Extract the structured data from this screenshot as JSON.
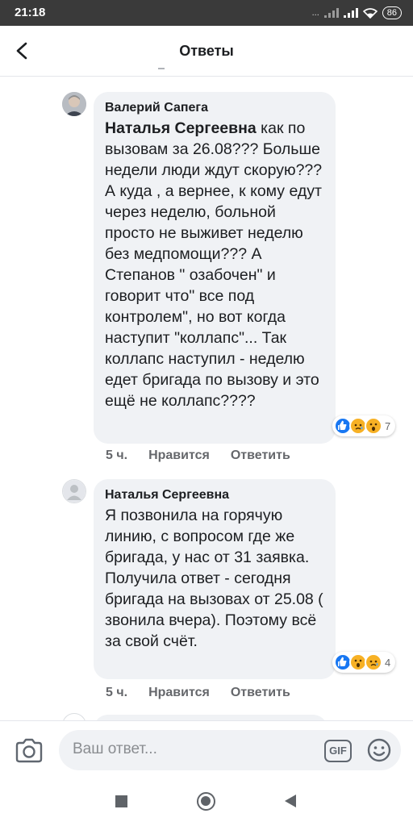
{
  "status_bar": {
    "time": "21:18",
    "signal_text": "...",
    "battery": "86"
  },
  "header": {
    "title": "Ответы",
    "back_icon": "back-arrow-icon"
  },
  "comments": [
    {
      "author": "Валерий Сапега",
      "mention": "Наталья Сергеевна",
      "text": " как по вызовам за 26.08??? Больше недели люди ждут скорую??? А куда , а вернее,  к кому  едут через неделю, больной просто не выживет неделю без медпомощи??? А Степанов \" озабочен\" и говорит что\" все под контролем\", но вот когда наступит \"коллапс\"... Так коллапс наступил - неделю едет бригада по вызову и это ещё не коллапс????",
      "reactions": [
        "like",
        "sad",
        "wow"
      ],
      "reaction_count": "7",
      "time": "5 ч.",
      "like_label": "Нравится",
      "reply_label": "Ответить"
    },
    {
      "author": "Наталья Сергеевна",
      "mention": "",
      "text": "Я позвонила на горячую линию, с вопросом где же бригада, у нас от 31 заявка. Получила ответ - сегодня бригада на вызовах от 25.08 ( звонила вчера). Поэтому всё за свой счёт.",
      "reactions": [
        "like",
        "wow",
        "sad"
      ],
      "reaction_count": "4",
      "time": "5 ч.",
      "like_label": "Нравится",
      "reply_label": "Ответить"
    }
  ],
  "composer": {
    "placeholder": "Ваш ответ...",
    "gif_label": "GIF",
    "camera_icon": "camera-icon",
    "emoji_icon": "smiley-icon"
  },
  "colors": {
    "accent": "#1877f2",
    "bubble": "#f0f2f5",
    "meta_text": "#65676b",
    "reaction_yellow": "#f7b125"
  }
}
